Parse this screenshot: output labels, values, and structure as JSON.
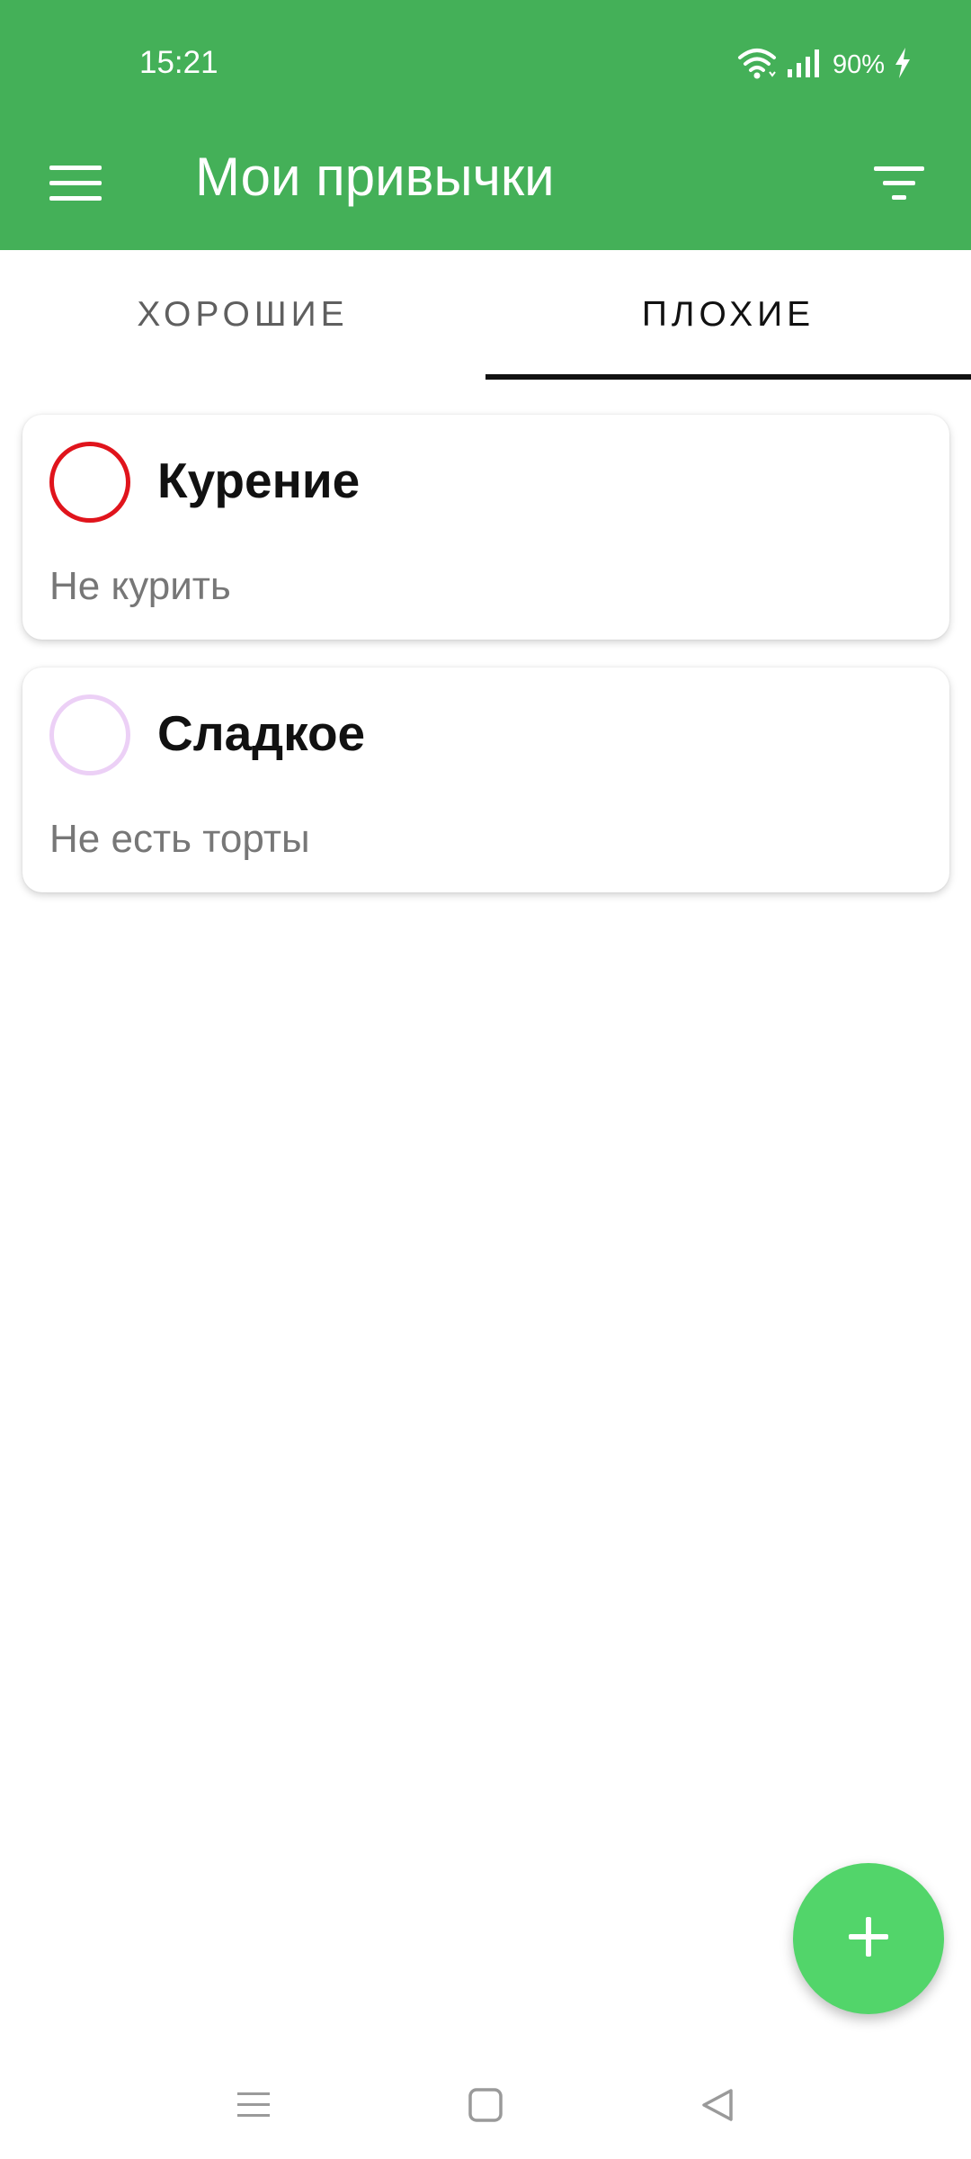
{
  "status_bar": {
    "time": "15:21",
    "battery": "90%",
    "icons": [
      "wifi-icon",
      "signal-icon",
      "charging-bolt-icon"
    ]
  },
  "toolbar": {
    "title": "Мои привычки",
    "menu_icon": "hamburger-menu-icon",
    "filter_icon": "filter-icon",
    "background_color": "#44b058"
  },
  "tabs": [
    {
      "label": "ХОРОШИЕ",
      "selected": false
    },
    {
      "label": "ПЛОХИЕ",
      "selected": true
    }
  ],
  "habits": [
    {
      "title": "Курение",
      "description": "Не курить",
      "color": "#e0141c"
    },
    {
      "title": "Сладкое",
      "description": "Не есть торты",
      "color": "#ecd0f6"
    }
  ],
  "fab": {
    "icon": "plus-icon",
    "color": "#52d56a"
  },
  "nav_bar": {
    "icons": [
      "recent-apps-icon",
      "home-icon",
      "back-icon"
    ]
  }
}
